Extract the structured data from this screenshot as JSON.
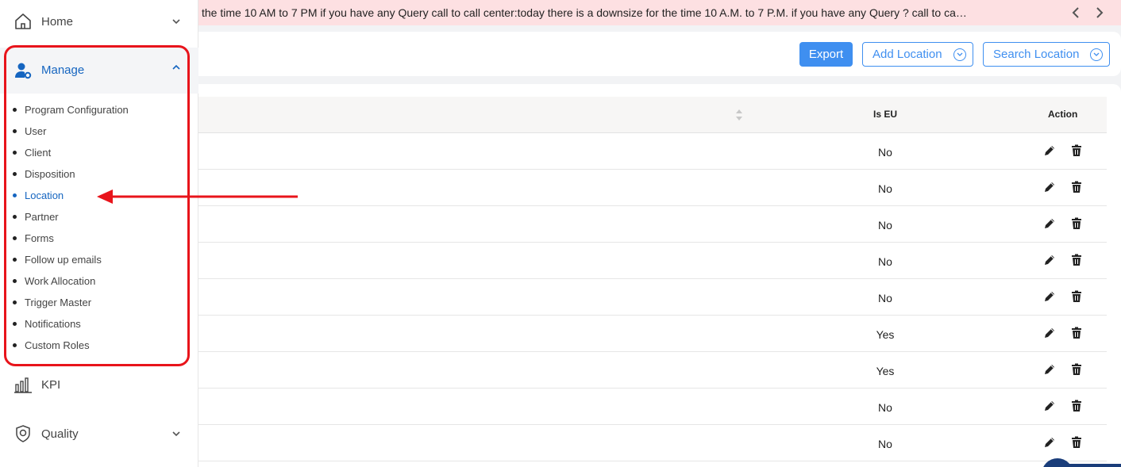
{
  "sidebar": {
    "home_label": "Home",
    "manage_label": "Manage",
    "sub_items": [
      {
        "label": "Program Configuration",
        "active": false
      },
      {
        "label": "User",
        "active": false
      },
      {
        "label": "Client",
        "active": false
      },
      {
        "label": "Disposition",
        "active": false
      },
      {
        "label": "Location",
        "active": true
      },
      {
        "label": "Partner",
        "active": false
      },
      {
        "label": "Forms",
        "active": false
      },
      {
        "label": "Follow up emails",
        "active": false
      },
      {
        "label": "Work Allocation",
        "active": false
      },
      {
        "label": "Trigger Master",
        "active": false
      },
      {
        "label": "Notifications",
        "active": false
      },
      {
        "label": "Custom Roles",
        "active": false
      }
    ],
    "kpi_label": "KPI",
    "quality_label": "Quality"
  },
  "marquee": {
    "text": "the time 10 AM to 7 PM if you have any Query call to call center:today there is a downsize for the time 10 A.M. to 7 P.M. if you have any Query ? call to ca…"
  },
  "toolbar": {
    "export_label": "Export",
    "add_location_label": "Add Location",
    "search_location_label": "Search Location"
  },
  "table": {
    "headers": {
      "is_eu": "Is EU",
      "action": "Action"
    },
    "rows": [
      {
        "is_eu": "No"
      },
      {
        "is_eu": "No"
      },
      {
        "is_eu": "No"
      },
      {
        "is_eu": "No"
      },
      {
        "is_eu": "No"
      },
      {
        "is_eu": "Yes"
      },
      {
        "is_eu": "Yes"
      },
      {
        "is_eu": "No"
      },
      {
        "is_eu": "No"
      }
    ]
  },
  "colors": {
    "accent": "#3f8ff0",
    "active_nav": "#1565c0",
    "annotation": "#e8141b",
    "marquee_bg": "#fde0e2"
  }
}
